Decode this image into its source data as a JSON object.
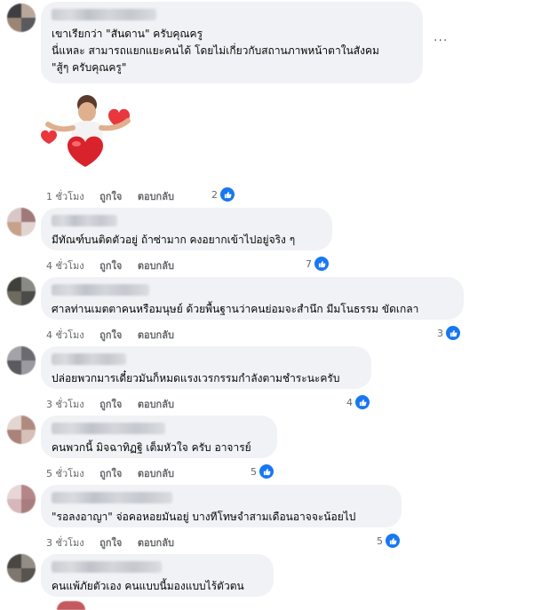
{
  "comments": [
    {
      "lines": [
        "เขาเรียกว่า \"สันดาน\" ครับคุณครู",
        "นี่แหละ สามารถแยกแยะคนได้ โดยไม่เกี่ยวกับสถานภาพหน้าตาในสังคม",
        "\"สู้ๆ ครับคุณครู\""
      ],
      "time": "1 ชั่วโมง",
      "like": "ถูกใจ",
      "reply": "ตอบกลับ",
      "reactions": "2"
    },
    {
      "lines": [
        "มีทัณฑ์บนติดตัวอยู่ ถ้าซ่ามาก คงอยากเข้าไปอยู่จริง ๆ"
      ],
      "time": "4 ชั่วโมง",
      "like": "ถูกใจ",
      "reply": "ตอบกลับ",
      "reactions": "7"
    },
    {
      "lines": [
        "ศาลท่านเมตตาคนหรือมนุษย์ ด้วยพื้นฐานว่าคนย่อมจะสำนึก มีมโนธรรม ขัดเกลา"
      ],
      "time": "4 ชั่วโมง",
      "like": "ถูกใจ",
      "reply": "ตอบกลับ",
      "reactions": "3"
    },
    {
      "lines": [
        "ปล่อยพวกมารเดี๋ยวมันก็หมดแรงเวรกรรมกำลังตามชำระนะครับ"
      ],
      "time": "3 ชั่วโมง",
      "like": "ถูกใจ",
      "reply": "ตอบกลับ",
      "reactions": "4"
    },
    {
      "lines": [
        "คนพวกนี้ มิจฉาทิฏฐิ เต็มหัวใจ ครับ อาจารย์"
      ],
      "time": "5 ชั่วโมง",
      "like": "ถูกใจ",
      "reply": "ตอบกลับ",
      "reactions": "5"
    },
    {
      "lines": [
        "\"รอลงอาญา\" จ่อคอหอยมันอยู่ บางทีโทษจำสามเดือนอาจจะน้อยไป"
      ],
      "time": "3 ชั่วโมง",
      "like": "ถูกใจ",
      "reply": "ตอบกลับ",
      "reactions": "5"
    },
    {
      "lines": [
        "คนแพ้ภัยตัวเอง คนแบบนี้มองแบบไร้ตัวตน"
      ]
    }
  ],
  "more_options": "···",
  "colors": {
    "like_blue": "#1877f2",
    "bubble_bg": "#f0f2f5",
    "meta_gray": "#65676b"
  }
}
